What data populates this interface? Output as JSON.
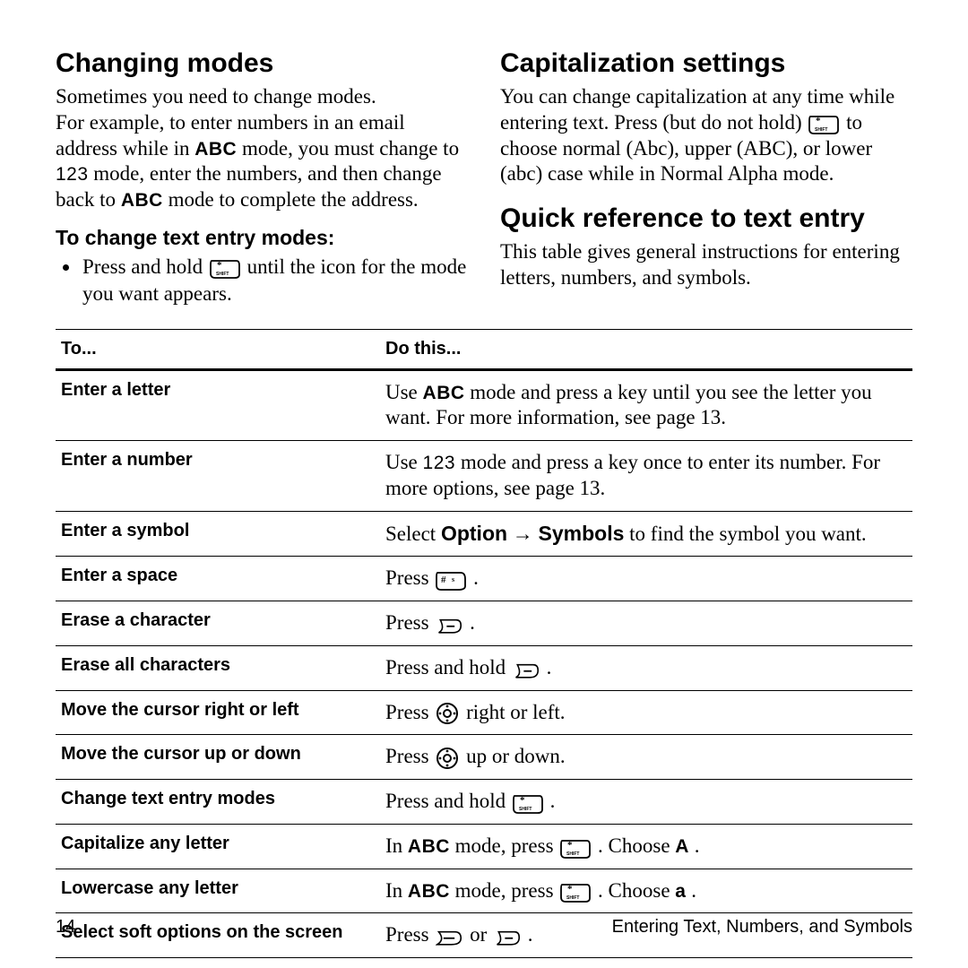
{
  "left": {
    "heading": "Changing modes",
    "para_parts": [
      "Sometimes you need to change modes. For example, to enter numbers in an email address while in ",
      " mode, you must change to ",
      " mode, enter the numbers, and then change back to ",
      " mode to complete the address."
    ],
    "abc_label": "ABC",
    "num_label": "123",
    "sub": "To change text entry modes:",
    "bullet_pre": "Press and hold ",
    "bullet_post": " until the icon for the mode you want appears."
  },
  "right": {
    "cap_heading": "Capitalization settings",
    "cap_para_parts": [
      "You can change capitalization at any time while entering text. Press (but do not hold) ",
      " to choose normal (Abc), upper (ABC), or lower (abc) case while in Normal Alpha mode."
    ],
    "quick_heading": "Quick reference to text entry",
    "quick_para": "This table gives general instructions for entering letters, numbers, and symbols."
  },
  "table": {
    "head_to": "To...",
    "head_do": "Do this...",
    "rows": [
      {
        "to": "Enter a letter",
        "pre": "Use ",
        "mid": " mode and press a key until you see the letter you want. For more information, see page 13.",
        "kind": "abc_text"
      },
      {
        "to": "Enter a number",
        "pre": "Use ",
        "mid": " mode and press a key once to enter its number. For more options, see page 13.",
        "kind": "num_text"
      },
      {
        "to": "Enter a symbol",
        "pre": "Select ",
        "opt": "Option",
        "arrow": " → ",
        "sym": "Symbols",
        "post": " to find the symbol you want.",
        "kind": "option_symbols"
      },
      {
        "to": "Enter a space",
        "pre": "Press ",
        "post": " .",
        "kind": "hash_key"
      },
      {
        "to": "Erase a character",
        "pre": "Press ",
        "post": " .",
        "kind": "back_key"
      },
      {
        "to": "Erase all characters",
        "pre": "Press and hold ",
        "post": " .",
        "kind": "back_key"
      },
      {
        "to": "Move the cursor right or left",
        "pre": "Press ",
        "post": " right or left.",
        "kind": "nav_key"
      },
      {
        "to": "Move the cursor up or down",
        "pre": "Press ",
        "post": " up or down.",
        "kind": "nav_key"
      },
      {
        "to": "Change text entry modes",
        "pre": "Press and hold ",
        "post": " .",
        "kind": "shift_key"
      },
      {
        "to": "Capitalize any letter",
        "pre": "In ",
        "mid": " mode, press ",
        "post": " . Choose ",
        "choice": "A",
        "tail": " .",
        "kind": "abc_shift_choice"
      },
      {
        "to": "Lowercase any letter",
        "pre": "In ",
        "mid": " mode, press ",
        "post": " . Choose ",
        "choice": "a",
        "tail": " .",
        "kind": "abc_shift_choice"
      },
      {
        "to": "Select soft options on the screen",
        "pre": "Press ",
        "mid": " or ",
        "post": " .",
        "kind": "soft_keys"
      }
    ],
    "abc_label": "ABC",
    "num_label": "123"
  },
  "footer": {
    "left": "14",
    "right": "Entering Text, Numbers, and Symbols"
  }
}
